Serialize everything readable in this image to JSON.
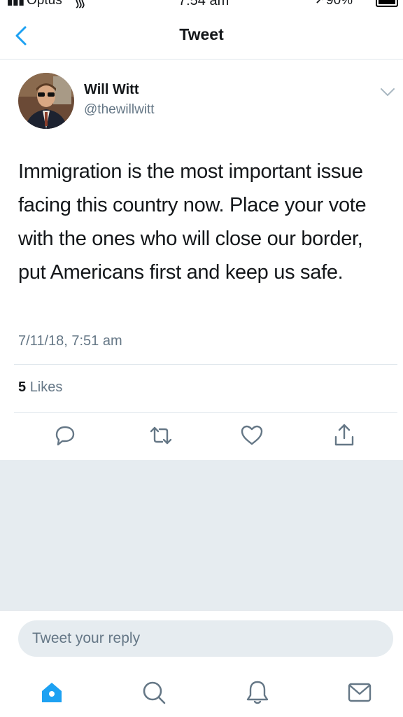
{
  "status_bar": {
    "carrier": "Optus",
    "time": "7:54 am",
    "battery": "90%"
  },
  "nav": {
    "title": "Tweet",
    "back_icon": "chevron-left-icon"
  },
  "tweet": {
    "author_name": "Will Witt",
    "author_handle": "@thewillwitt",
    "text": "Immigration is the most important issue facing this country now. Place your vote with the ones who will close our border, put Americans first and keep us safe.",
    "timestamp": "7/11/18, 7:51 am",
    "likes_count": "5",
    "likes_label": "Likes"
  },
  "actions": [
    "reply-icon",
    "retweet-icon",
    "like-icon",
    "share-icon"
  ],
  "reply": {
    "placeholder": "Tweet your reply"
  },
  "tabs": [
    "home-icon",
    "search-icon",
    "notifications-icon",
    "messages-icon"
  ],
  "colors": {
    "accent": "#1da1f2",
    "secondary_text": "#657786",
    "gray_background": "#e6ecf0"
  }
}
